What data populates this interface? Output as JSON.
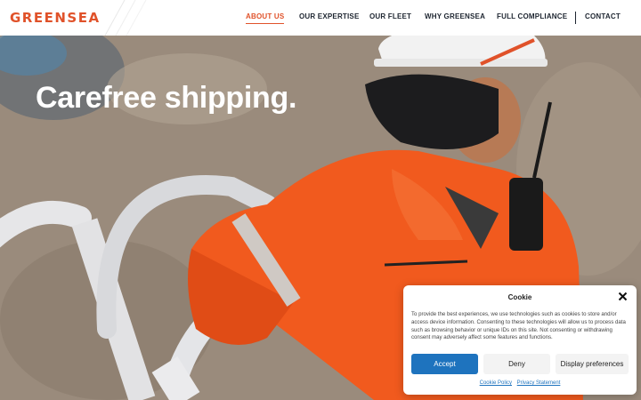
{
  "header": {
    "logo_text": "GREENSEA",
    "nav": [
      {
        "label": "ABOUT US",
        "active": true
      },
      {
        "label": "OUR EXPERTISE",
        "active": false
      },
      {
        "label": "OUR FLEET",
        "active": false
      },
      {
        "label": "WHY GREENSEA",
        "active": false
      },
      {
        "label": "FULL COMPLIANCE",
        "active": false
      },
      {
        "label": "CONTACT",
        "active": false
      }
    ]
  },
  "hero": {
    "title": "Carefree shipping."
  },
  "cookie": {
    "title": "Cookie",
    "text": "To provide the best experiences, we use technologies such as cookies to store and/or access device information. Consenting to these technologies will allow us to process data such as browsing behavior or unique IDs on this site. Not consenting or withdrawing consent may adversely affect some features and functions.",
    "accept_label": "Accept",
    "deny_label": "Deny",
    "prefs_label": "Display preferences",
    "cookie_policy_label": "Cookie Policy",
    "privacy_label": "Privacy Statement"
  },
  "colors": {
    "brand": "#e0522a",
    "accept": "#1e73be",
    "nav_text": "#1d2530"
  }
}
